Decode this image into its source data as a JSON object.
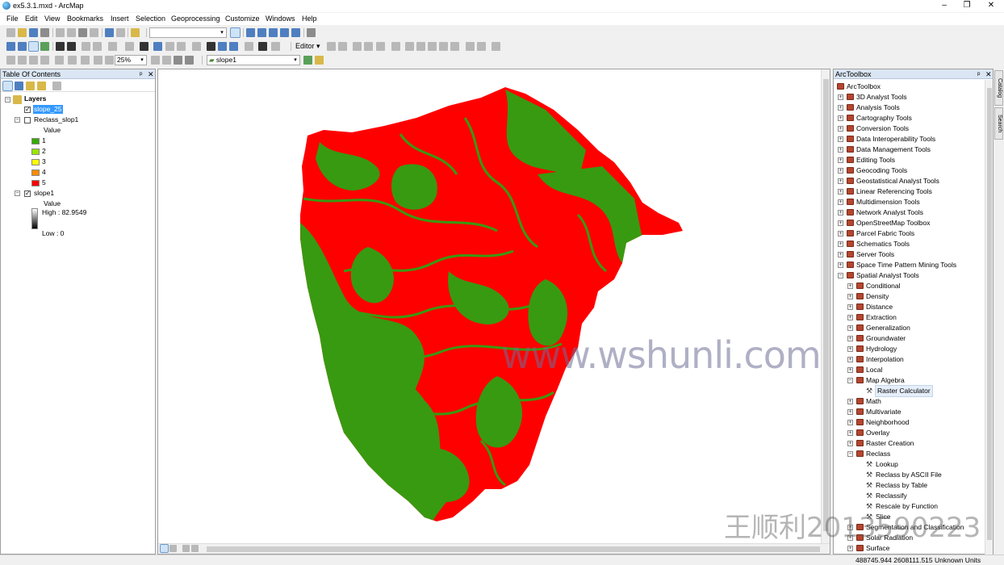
{
  "window": {
    "title": "ex5.3.1.mxd - ArcMap",
    "minimize": "–",
    "maximize": "❐",
    "close": "✕"
  },
  "menu": [
    "File",
    "Edit",
    "View",
    "Bookmarks",
    "Insert",
    "Selection",
    "Geoprocessing",
    "Customize",
    "Windows",
    "Help"
  ],
  "toolbars": {
    "scale_value": "",
    "zoom_percent": "25%",
    "editor_label": "Editor ▾",
    "layer_combo": "slope1"
  },
  "toc": {
    "title": "Table Of Contents",
    "pin": "ᵖ",
    "close": "✕",
    "group": "Layers",
    "layers": [
      {
        "name": "slope_25",
        "checked": true,
        "selected": true
      },
      {
        "name": "Reclass_slop1",
        "checked": false,
        "field": "Value",
        "classes": [
          {
            "label": "1",
            "color": "#38a800"
          },
          {
            "label": "2",
            "color": "#98e600"
          },
          {
            "label": "3",
            "color": "#ffff00"
          },
          {
            "label": "4",
            "color": "#ff8c00"
          },
          {
            "label": "5",
            "color": "#ff0000"
          }
        ]
      },
      {
        "name": "slope1",
        "checked": true,
        "field": "Value",
        "high": "High : 82.9549",
        "low": "Low : 0"
      }
    ]
  },
  "map": {
    "watermark": "www.wshunli.com",
    "colors": {
      "steep": "#ff0000",
      "gentle": "#389a10"
    }
  },
  "arctoolbox": {
    "title": "ArcToolbox",
    "root": "ArcToolbox",
    "toolboxes": [
      "3D Analyst Tools",
      "Analysis Tools",
      "Cartography Tools",
      "Conversion Tools",
      "Data Interoperability Tools",
      "Data Management Tools",
      "Editing Tools",
      "Geocoding Tools",
      "Geostatistical Analyst Tools",
      "Linear Referencing Tools",
      "Multidimension Tools",
      "Network Analyst Tools",
      "OpenStreetMap Toolbox",
      "Parcel Fabric Tools",
      "Schematics Tools",
      "Server Tools",
      "Space Time Pattern Mining Tools",
      "Spatial Analyst Tools"
    ],
    "spatial_children": [
      {
        "name": "Conditional"
      },
      {
        "name": "Density"
      },
      {
        "name": "Distance"
      },
      {
        "name": "Extraction"
      },
      {
        "name": "Generalization"
      },
      {
        "name": "Groundwater"
      },
      {
        "name": "Hydrology"
      },
      {
        "name": "Interpolation"
      },
      {
        "name": "Local"
      },
      {
        "name": "Map Algebra",
        "open": true,
        "tools": [
          "Raster Calculator"
        ]
      },
      {
        "name": "Math"
      },
      {
        "name": "Multivariate"
      },
      {
        "name": "Neighborhood"
      },
      {
        "name": "Overlay"
      },
      {
        "name": "Raster Creation"
      },
      {
        "name": "Reclass",
        "open": true,
        "tools": [
          "Lookup",
          "Reclass by ASCII File",
          "Reclass by Table",
          "Reclassify",
          "Rescale by Function",
          "Slice"
        ]
      },
      {
        "name": "Segmentation and Classification"
      },
      {
        "name": "Solar Radiation"
      },
      {
        "name": "Surface"
      }
    ],
    "selected_tool": "Raster Calculator"
  },
  "sidetabs": [
    "Catalog",
    "Search"
  ],
  "status": {
    "coords": "488745.944  2608111.515 Unknown Units"
  },
  "overlay_watermark": "王顺利2013590223"
}
